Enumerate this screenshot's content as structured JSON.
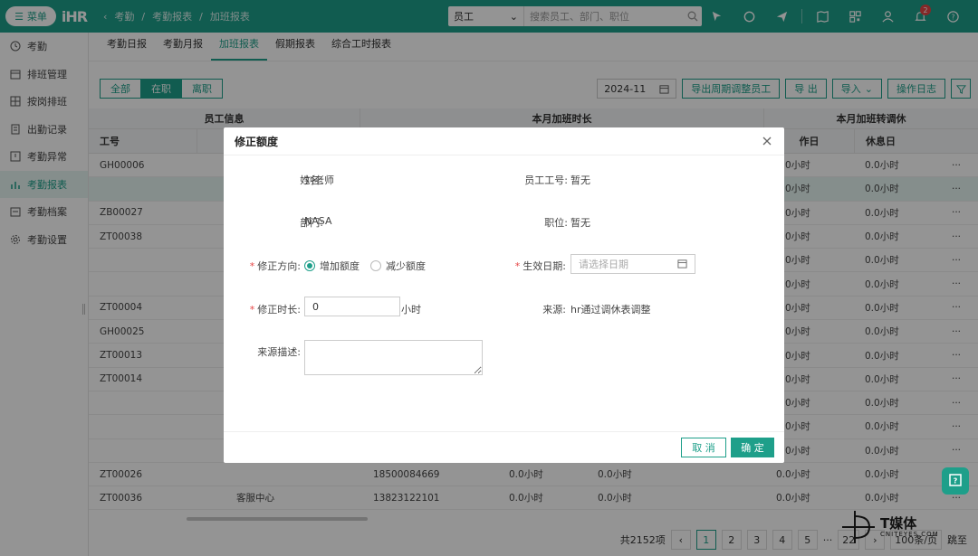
{
  "topbar": {
    "menu_label": "菜单",
    "logo": "iHR",
    "breadcrumbs": [
      "考勤",
      "/",
      "考勤报表",
      "/",
      "加班报表"
    ],
    "search_scope": "员工",
    "search_placeholder": "搜索员工、部门、职位",
    "notification_count": "2"
  },
  "sidebar": {
    "items": [
      {
        "label": "考勤",
        "icon": "clock-icon"
      },
      {
        "label": "排班管理",
        "icon": "calendar-icon"
      },
      {
        "label": "按岗排班",
        "icon": "grid-icon"
      },
      {
        "label": "出勤记录",
        "icon": "document-icon"
      },
      {
        "label": "考勤异常",
        "icon": "alert-icon"
      },
      {
        "label": "考勤报表",
        "icon": "chart-icon"
      },
      {
        "label": "考勤档案",
        "icon": "folder-icon"
      },
      {
        "label": "考勤设置",
        "icon": "gear-icon"
      }
    ],
    "active_index": 5
  },
  "tabs": [
    "考勤日报",
    "考勤月报",
    "加班报表",
    "假期报表",
    "综合工时报表"
  ],
  "active_tab": 2,
  "filters": [
    "全部",
    "在职",
    "离职"
  ],
  "active_filter": 1,
  "toolbar": {
    "month": "2024-11",
    "export_cycle": "导出周期调整员工",
    "export": "导 出",
    "import": "导入",
    "log": "操作日志"
  },
  "table": {
    "group_headers": [
      "员工信息",
      "本月加班时长",
      "本月加班转调休"
    ],
    "sub_headers": [
      "工号",
      "作日",
      "休息日"
    ],
    "rows": [
      {
        "id": "GH00006",
        "dept": "",
        "phone": "",
        "a": "",
        "b": "",
        "c": "0.0小时",
        "d": "0.0小时"
      },
      {
        "id": "",
        "dept": "",
        "phone": "",
        "a": "",
        "b": "",
        "c": "0.0小时",
        "d": "0.0小时"
      },
      {
        "id": "ZB00027",
        "dept": "",
        "phone": "",
        "a": "",
        "b": "",
        "c": "0.0小时",
        "d": "0.0小时"
      },
      {
        "id": "ZT00038",
        "dept": "",
        "phone": "",
        "a": "",
        "b": "",
        "c": "0.0小时",
        "d": "0.0小时"
      },
      {
        "id": "",
        "dept": "",
        "phone": "",
        "a": "",
        "b": "",
        "c": "0.0小时",
        "d": "0.0小时"
      },
      {
        "id": "",
        "dept": "",
        "phone": "",
        "a": "",
        "b": "",
        "c": "0.0小时",
        "d": "0.0小时"
      },
      {
        "id": "ZT00004",
        "dept": "",
        "phone": "",
        "a": "",
        "b": "",
        "c": "0.0小时",
        "d": "0.0小时"
      },
      {
        "id": "GH00025",
        "dept": "",
        "phone": "",
        "a": "",
        "b": "",
        "c": "0.0小时",
        "d": "0.0小时"
      },
      {
        "id": "ZT00013",
        "dept": "",
        "phone": "",
        "a": "",
        "b": "",
        "c": "0.0小时",
        "d": "0.0小时"
      },
      {
        "id": "ZT00014",
        "dept": "",
        "phone": "",
        "a": "",
        "b": "",
        "c": "0.0小时",
        "d": "0.0小时"
      },
      {
        "id": "",
        "dept": "",
        "phone": "",
        "a": "",
        "b": "",
        "c": "0.0小时",
        "d": "0.0小时"
      },
      {
        "id": "",
        "dept": "",
        "phone": "",
        "a": "",
        "b": "",
        "c": "0.0小时",
        "d": "0.0小时"
      },
      {
        "id": "",
        "dept": "",
        "phone": "",
        "a": "",
        "b": "",
        "c": "0.0小时",
        "d": "0.0小时"
      },
      {
        "id": "ZT00026",
        "dept": "",
        "phone": "18500084669",
        "a": "0.0小时",
        "b": "0.0小时",
        "c": "0.0小时",
        "d": "0.0小时"
      },
      {
        "id": "ZT00036",
        "dept": "客服中心",
        "phone": "13823122101",
        "a": "0.0小时",
        "b": "0.0小时",
        "c": "0.0小时",
        "d": "0.0小时"
      }
    ],
    "more": "···"
  },
  "pager": {
    "total": "共2152项",
    "pages": [
      "1",
      "2",
      "3",
      "4",
      "5",
      "···",
      "22"
    ],
    "per_page": "100条/页",
    "goto": "跳至"
  },
  "modal": {
    "title": "修正额度",
    "name_label": "姓名:",
    "name_value": "刘老师",
    "empno_label": "员工工号:",
    "empno_value": "暂无",
    "dept_label": "部门:",
    "dept_value": "NASA",
    "position_label": "职位:",
    "position_value": "暂无",
    "direction_label": "修正方向:",
    "direction_add": "增加额度",
    "direction_reduce": "减少额度",
    "effective_label": "生效日期:",
    "effective_placeholder": "请选择日期",
    "duration_label": "修正时长:",
    "duration_value": "0",
    "duration_unit": "小时",
    "source_label": "来源:",
    "source_value": "hr通过调休表调整",
    "desc_label": "来源描述:",
    "cancel": "取 消",
    "ok": "确 定"
  },
  "watermark": {
    "brand": "T媒体",
    "sub": "CNITEYES.COM"
  }
}
